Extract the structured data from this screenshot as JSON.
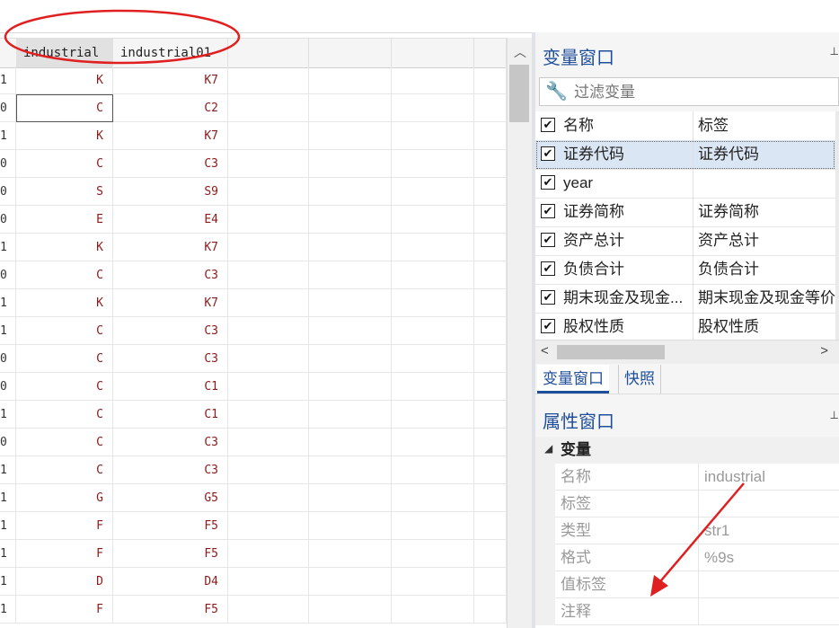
{
  "grid": {
    "columns": [
      "industrial",
      "industrial01"
    ],
    "rows": [
      {
        "obs": "1",
        "industrial": "K",
        "industrial01": "K7"
      },
      {
        "obs": "0",
        "industrial": "C",
        "industrial01": "C2"
      },
      {
        "obs": "1",
        "industrial": "K",
        "industrial01": "K7"
      },
      {
        "obs": "0",
        "industrial": "C",
        "industrial01": "C3"
      },
      {
        "obs": "0",
        "industrial": "S",
        "industrial01": "S9"
      },
      {
        "obs": "0",
        "industrial": "E",
        "industrial01": "E4"
      },
      {
        "obs": "1",
        "industrial": "K",
        "industrial01": "K7"
      },
      {
        "obs": "0",
        "industrial": "C",
        "industrial01": "C3"
      },
      {
        "obs": "1",
        "industrial": "K",
        "industrial01": "K7"
      },
      {
        "obs": "1",
        "industrial": "C",
        "industrial01": "C3"
      },
      {
        "obs": "0",
        "industrial": "C",
        "industrial01": "C3"
      },
      {
        "obs": "0",
        "industrial": "C",
        "industrial01": "C1"
      },
      {
        "obs": "1",
        "industrial": "C",
        "industrial01": "C1"
      },
      {
        "obs": "0",
        "industrial": "C",
        "industrial01": "C3"
      },
      {
        "obs": "1",
        "industrial": "C",
        "industrial01": "C3"
      },
      {
        "obs": "1",
        "industrial": "G",
        "industrial01": "G5"
      },
      {
        "obs": "1",
        "industrial": "F",
        "industrial01": "F5"
      },
      {
        "obs": "1",
        "industrial": "F",
        "industrial01": "F5"
      },
      {
        "obs": "1",
        "industrial": "D",
        "industrial01": "D4"
      },
      {
        "obs": "1",
        "industrial": "F",
        "industrial01": "F5"
      }
    ]
  },
  "variables_window": {
    "title": "变量窗口",
    "filter_placeholder": "过滤变量",
    "col_name": "名称",
    "col_label": "标签",
    "items": [
      {
        "name": "证券代码",
        "label": "证券代码"
      },
      {
        "name": "year",
        "label": ""
      },
      {
        "name": "证券简称",
        "label": "证券简称"
      },
      {
        "name": "资产总计",
        "label": "资产总计"
      },
      {
        "name": "负债合计",
        "label": "负债合计"
      },
      {
        "name": "期末现金及现金...",
        "label": "期末现金及现金等价"
      },
      {
        "name": "股权性质",
        "label": "股权性质"
      }
    ],
    "tabs": [
      "变量窗口",
      "快照"
    ]
  },
  "properties_window": {
    "title": "属性窗口",
    "group": "变量",
    "rows": [
      {
        "name": "名称",
        "value": "industrial"
      },
      {
        "name": "标签",
        "value": ""
      },
      {
        "name": "类型",
        "value": "str1"
      },
      {
        "name": "格式",
        "value": "%9s"
      },
      {
        "name": "值标签",
        "value": ""
      },
      {
        "name": "注释",
        "value": ""
      }
    ]
  },
  "colors": {
    "accent": "#1f4e9a",
    "cell_text": "#8b1a1a",
    "annotation": "#e02020"
  },
  "icons": {
    "pin": "pin-icon",
    "wrench": "wrench-icon",
    "check": "checkbox-icon"
  }
}
